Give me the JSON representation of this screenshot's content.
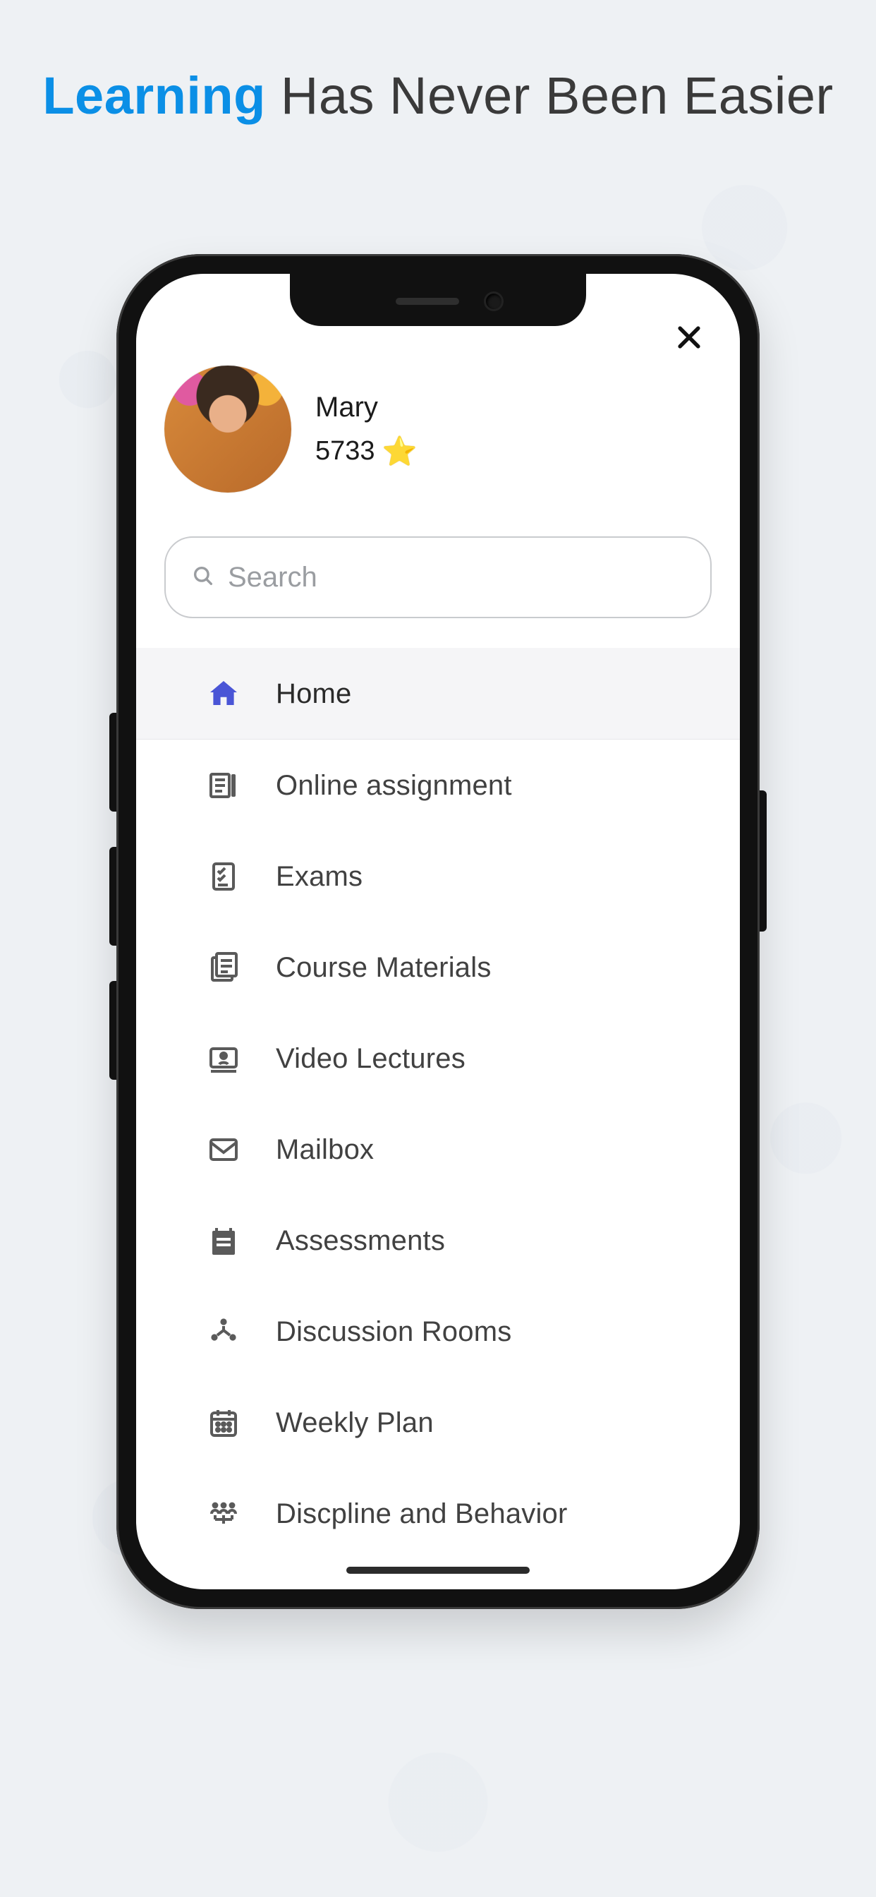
{
  "headline": {
    "accent": "Learning",
    "rest": " Has Never Been Easier"
  },
  "profile": {
    "name": "Mary",
    "points": "5733"
  },
  "search": {
    "placeholder": "Search"
  },
  "menu": {
    "items": [
      {
        "id": "home",
        "label": "Home",
        "icon": "home-icon",
        "active": true
      },
      {
        "id": "assignment",
        "label": "Online assignment",
        "icon": "assignment-icon",
        "active": false
      },
      {
        "id": "exams",
        "label": "Exams",
        "icon": "exams-icon",
        "active": false
      },
      {
        "id": "materials",
        "label": "Course Materials",
        "icon": "materials-icon",
        "active": false
      },
      {
        "id": "video",
        "label": "Video Lectures",
        "icon": "video-icon",
        "active": false
      },
      {
        "id": "mailbox",
        "label": "Mailbox",
        "icon": "mailbox-icon",
        "active": false
      },
      {
        "id": "assessments",
        "label": "Assessments",
        "icon": "assessments-icon",
        "active": false
      },
      {
        "id": "discussion",
        "label": "Discussion Rooms",
        "icon": "discussion-icon",
        "active": false
      },
      {
        "id": "weekly",
        "label": "Weekly Plan",
        "icon": "calendar-icon",
        "active": false
      },
      {
        "id": "discipline",
        "label": "Discpline and Behavior",
        "icon": "group-icon",
        "active": false
      }
    ]
  },
  "colors": {
    "accent": "#0b8fe6",
    "activeIcon": "#4a55d6"
  }
}
